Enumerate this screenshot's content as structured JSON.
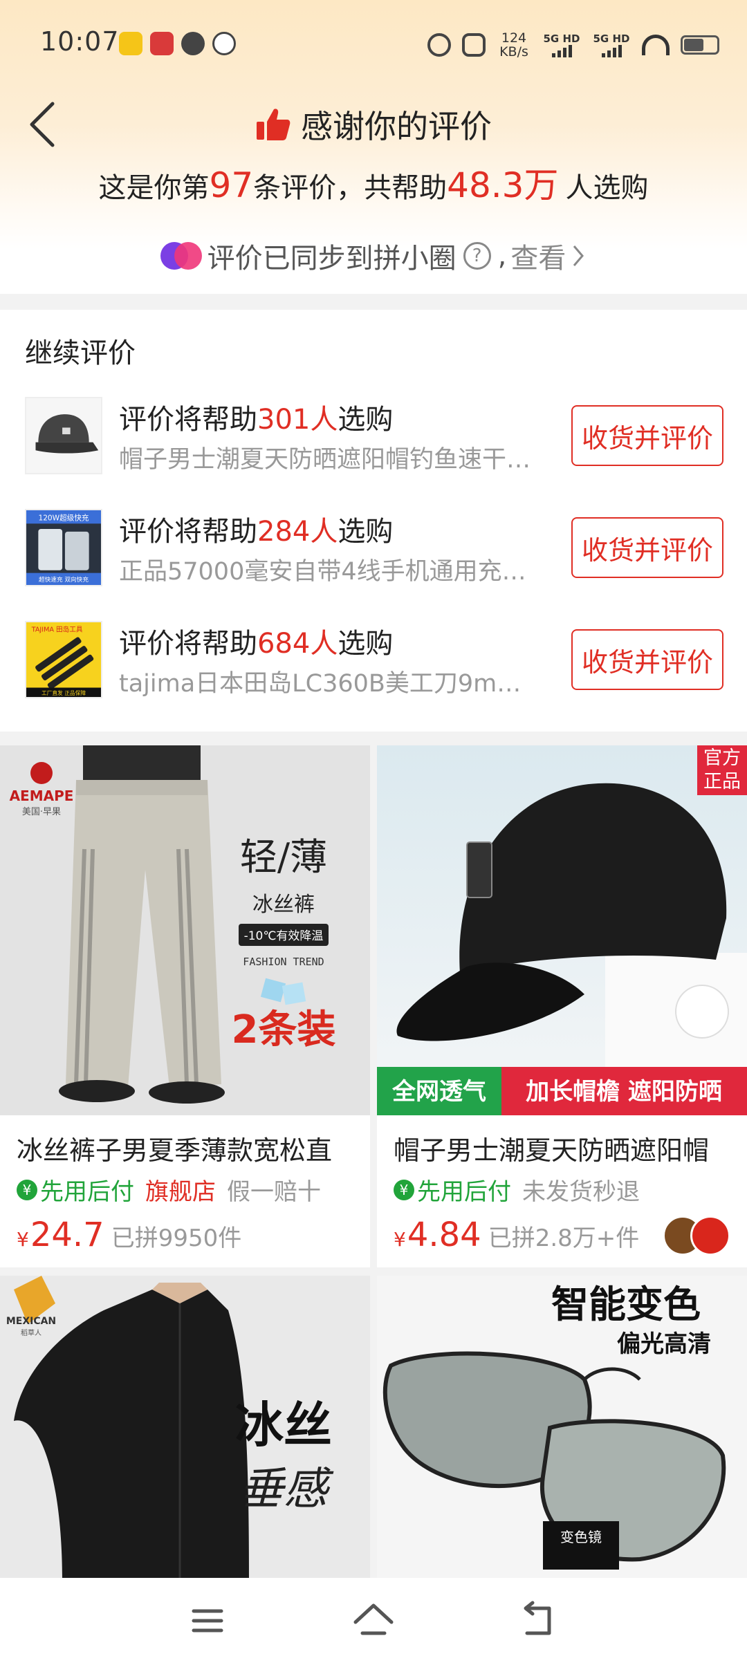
{
  "status_bar": {
    "time": "10:07",
    "net_speed_value": "124",
    "net_speed_unit": "KB/s",
    "sim1": "5G HD",
    "sim2": "5G HD"
  },
  "header": {
    "title": "感谢你的评价",
    "subtitle_prefix": "这是你第",
    "review_count": "97",
    "subtitle_mid": "条评价，共帮助",
    "helped_count": "48.3万",
    "subtitle_suffix": "人选购",
    "sync_text": "评价已同步到拼小圈",
    "sync_help": "?",
    "sync_sep": ",",
    "sync_view": "查看"
  },
  "continue_review": {
    "heading": "继续评价",
    "items": [
      {
        "title_prefix": "评价将帮助",
        "count": "301人",
        "title_suffix": "选购",
        "product": "帽子男士潮夏天防晒遮阳帽钓鱼速干鸭舌帽",
        "button": "收货并评价"
      },
      {
        "title_prefix": "评价将帮助",
        "count": "284人",
        "title_suffix": "选购",
        "product": "正品57000毫安自带4线手机通用充电宝",
        "button": "收货并评价",
        "thumb_text_top": "120W超级快充",
        "thumb_text_bottom": "超快速充 双向快充"
      },
      {
        "title_prefix": "评价将帮助",
        "count": "684人",
        "title_suffix": "选购",
        "product": "tajima日本田岛LC360B美工刀9mm刀片",
        "button": "收货并评价",
        "thumb_text_top": "TAJIMA 田岛工具",
        "thumb_text_bottom": "工厂直发 正品保障"
      }
    ]
  },
  "products": [
    {
      "title": "冰丝裤子男夏季薄款宽松直",
      "tag_green": "先用后付",
      "tag_red": "旗舰店",
      "tag_gray": "假一赔十",
      "yen": "¥",
      "price": "24.7",
      "sold": "已拼9950件",
      "img_brand": "AEMAPE",
      "img_brand_sub": "美国·早果",
      "img_text1": "轻/薄",
      "img_text2": "冰丝裤",
      "img_text3": "-10℃有效降温",
      "img_text4": "FASHION TREND",
      "img_text5": "2条装"
    },
    {
      "title": "帽子男士潮夏天防晒遮阳帽",
      "tag_green": "先用后付",
      "tag_gray": "未发货秒退",
      "yen": "¥",
      "price": "4.84",
      "sold": "已拼2.8万+件",
      "img_badge": "官方正品",
      "img_banner_left": "全网透气",
      "img_banner_right": "加长帽檐 遮阳防晒"
    },
    {
      "img_brand": "MEXICAN",
      "img_brand_sub": "稻草人",
      "img_text1": "冰丝",
      "img_text2": "垂感"
    },
    {
      "img_text1": "智能变色",
      "img_text2": "偏光高清",
      "img_text3": "变色镜"
    }
  ]
}
